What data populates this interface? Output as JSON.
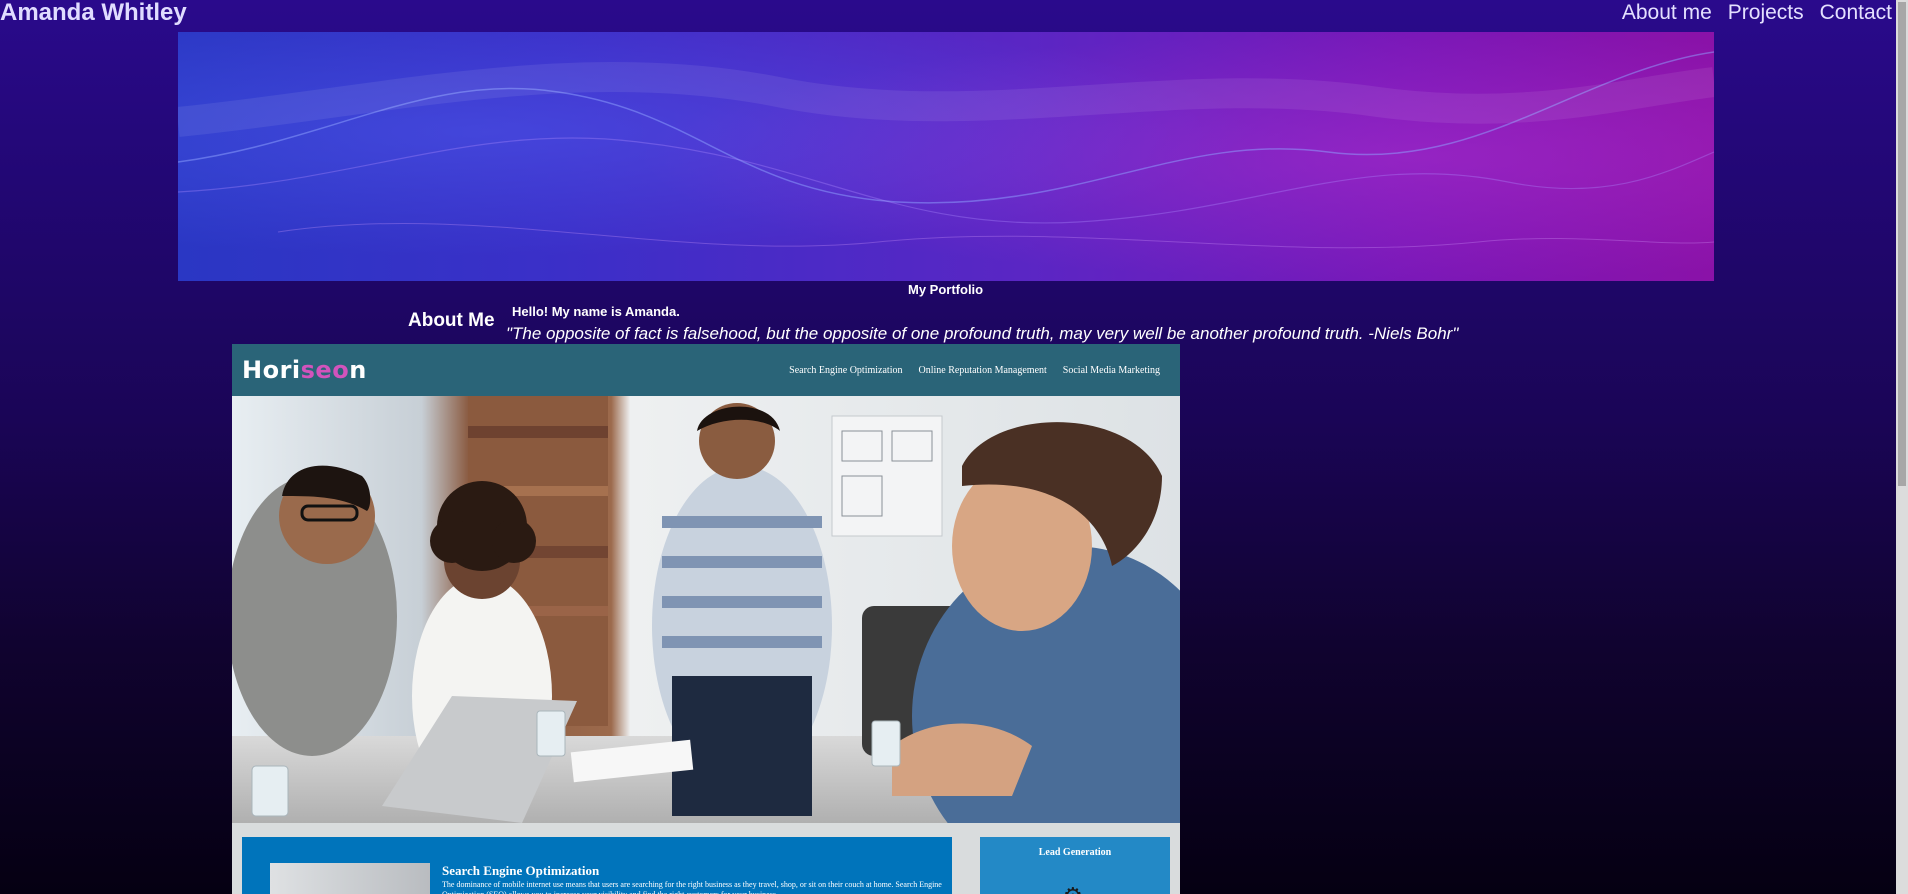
{
  "header": {
    "site_title": "Amanda Whitley",
    "nav": [
      "About me",
      "Projects",
      "Contact"
    ]
  },
  "portfolio_label": "My Portfolio",
  "about": {
    "heading": "About Me",
    "hello": "Hello! My name is Amanda.",
    "quote": "\"The opposite of fact is falsehood, but the opposite of one profound truth, may very well be another profound truth. -Niels Bohr\""
  },
  "project": {
    "logo_part1": "Hori",
    "logo_part2": "seo",
    "logo_part3": "n",
    "nav": [
      "Search Engine Optimization",
      "Online Reputation Management",
      "Social Media Marketing"
    ],
    "seo_title": "Search Engine Optimization",
    "seo_body": "The dominance of mobile internet use means that users are searching for the right business as they travel, shop, or sit on their couch at home. Search Engine Optimization (SEO) allows you to increase your visibility and find the right customers for your business.",
    "lead_title": "Lead Generation",
    "gear_icon": "⚙"
  },
  "colors": {
    "page_top": "#2a0a8c",
    "page_bottom": "#050012",
    "card_header": "#2a6478",
    "seo_accent": "#d253bc",
    "seo_block": "#0074bb",
    "lead_block": "#2389c6"
  }
}
